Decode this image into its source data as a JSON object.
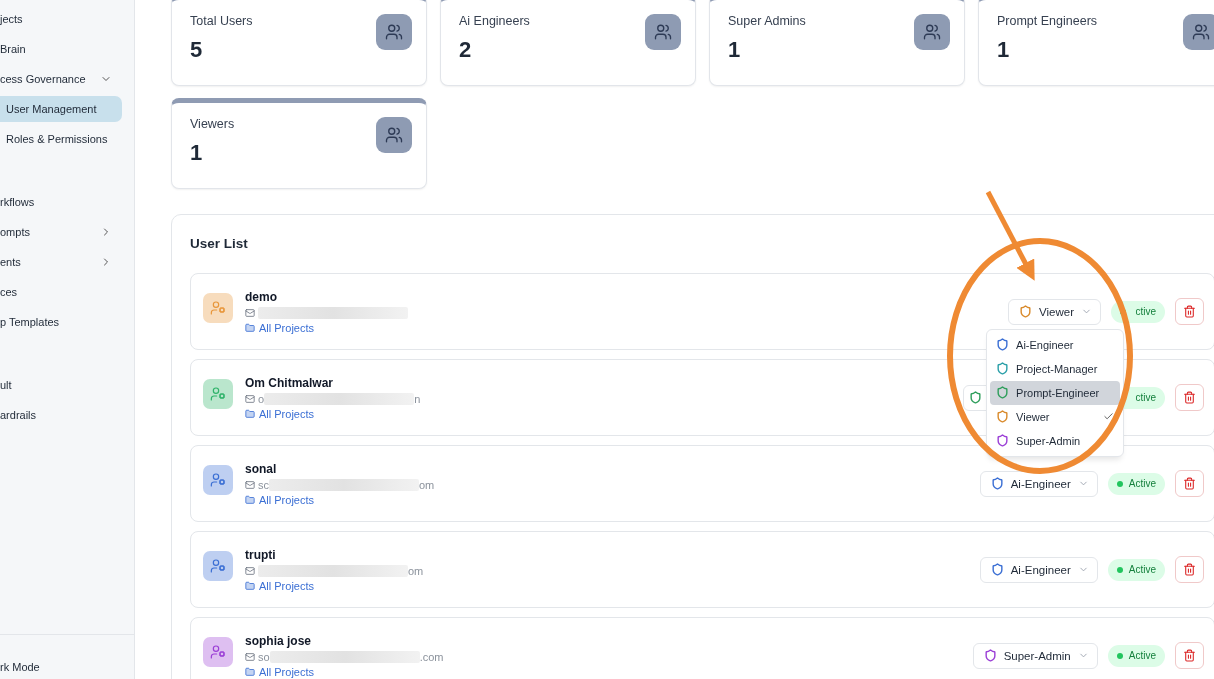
{
  "sidebar": {
    "groups": [
      [
        {
          "label": "jects",
          "selected": false
        },
        {
          "label": "Brain",
          "selected": false
        },
        {
          "label": "cess Governance",
          "selected": false,
          "expanded": true,
          "children": [
            {
              "label": "User Management",
              "selected": true
            },
            {
              "label": "Roles & Permissions",
              "selected": false
            }
          ]
        }
      ],
      [
        {
          "label": "rkflows",
          "selected": false
        },
        {
          "label": "ompts",
          "selected": false,
          "expanded": false
        },
        {
          "label": "ents",
          "selected": false,
          "expanded": false
        },
        {
          "label": "ces",
          "selected": false
        },
        {
          "label": "p Templates",
          "selected": false
        }
      ],
      [
        {
          "label": "ult",
          "selected": false
        },
        {
          "label": "ardrails",
          "selected": false
        }
      ]
    ],
    "footer": "rk Mode"
  },
  "stats": [
    {
      "label": "Total Users",
      "value": "5"
    },
    {
      "label": "Ai Engineers",
      "value": "2"
    },
    {
      "label": "Super Admins",
      "value": "1"
    },
    {
      "label": "Prompt Engineers",
      "value": "1"
    },
    {
      "label": "Viewers",
      "value": "1"
    }
  ],
  "user_list": {
    "title": "User List",
    "users": [
      {
        "name": "demo",
        "color": "#e8963a",
        "projects": "All Projects",
        "role": {
          "label": "Viewer",
          "color": "#d98a2b"
        },
        "status": "ctive",
        "role_menu": {
          "options": [
            {
              "label": "Ai-Engineer",
              "color": "#3b6fd4",
              "selected": false,
              "highlighted": false
            },
            {
              "label": "Project-Manager",
              "color": "#2a9fa8",
              "selected": false,
              "highlighted": false
            },
            {
              "label": "Prompt-Engineer",
              "color": "#2e9e5b",
              "selected": false,
              "highlighted": true
            },
            {
              "label": "Viewer",
              "color": "#d98a2b",
              "selected": true,
              "highlighted": false
            },
            {
              "label": "Super-Admin",
              "color": "#9b3fd6",
              "selected": false,
              "highlighted": false
            }
          ]
        }
      },
      {
        "name": "Om Chitmalwar",
        "color": "#2fb36a",
        "email_parts": [
          "o",
          "n"
        ],
        "projects": "All Projects",
        "role": {
          "color": "#2e9e5b"
        },
        "status": "ctive"
      },
      {
        "name": "sonal",
        "color": "#3b6fd4",
        "email_parts": [
          "sc",
          "om"
        ],
        "projects": "All Projects",
        "role": {
          "label": "Ai-Engineer",
          "color": "#3b6fd4"
        },
        "status": "Active"
      },
      {
        "name": "trupti",
        "color": "#3b6fd4",
        "email_end": "om",
        "projects": "All Projects",
        "role": {
          "label": "Ai-Engineer",
          "color": "#3b6fd4"
        },
        "status": "Active"
      },
      {
        "name": "sophia jose",
        "color": "#9b3fd6",
        "email_parts": [
          "so",
          ".com"
        ],
        "projects": "All Projects",
        "role": {
          "label": "Super-Admin",
          "color": "#9b3fd6"
        },
        "status": "Active"
      }
    ]
  }
}
